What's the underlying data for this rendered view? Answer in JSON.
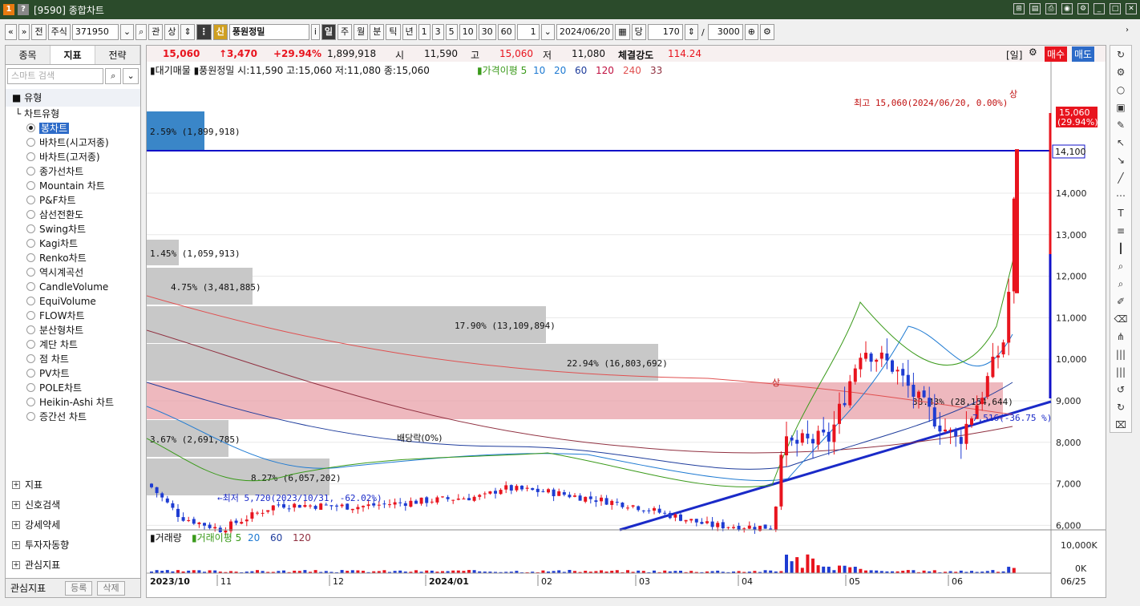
{
  "window": {
    "code": "[9590]",
    "title": "종합차트"
  },
  "toolbar": {
    "prev": "«",
    "next": "»",
    "all": "전",
    "market": "주식",
    "code": "371950",
    "search_btn": "⌕",
    "kwan": "관",
    "sang": "상",
    "sin": "신",
    "name": "풍원정밀",
    "info": "i",
    "periods": [
      "일",
      "주",
      "월",
      "분",
      "틱",
      "년"
    ],
    "active_period": "일",
    "nums": [
      "1",
      "3",
      "5",
      "10",
      "30",
      "60"
    ],
    "count": "1",
    "date": "2024/06/20",
    "dang": "당",
    "view": "170",
    "slash": "/",
    "total": "3000"
  },
  "left": {
    "tabs": [
      "종목",
      "지표",
      "전략"
    ],
    "active_tab": "지표",
    "search_placeholder": "스마트 검색",
    "group_label": "유형",
    "sub_label": "차트유형",
    "chart_types": [
      "봉차트",
      "바차트(시고저종)",
      "바차트(고저종)",
      "종가선차트",
      "Mountain 차트",
      "P&F차트",
      "삼선전환도",
      "Swing차트",
      "Kagi차트",
      "Renko차트",
      "역시계곡선",
      "CandleVolume",
      "EquiVolume",
      "FLOW차트",
      "분산형차트",
      "계단 차트",
      "점 차트",
      "PV차트",
      "POLE차트",
      "Heikin-Ashi 차트",
      "증간선 차트"
    ],
    "selected_type": "봉차트",
    "nodes": [
      "지표",
      "신호검색",
      "강세약세",
      "투자자동향",
      "관심지표"
    ],
    "footer": {
      "label": "관심지표",
      "register": "등록",
      "delete": "삭제"
    }
  },
  "quote": {
    "price": "15,060",
    "change": "↑3,470",
    "pct": "+29.94%",
    "volume": "1,899,918",
    "open_label": "시",
    "open": "11,590",
    "high_label": "고",
    "high": "15,060",
    "low_label": "저",
    "low": "11,080",
    "strength_label": "체결강도",
    "strength": "114.24",
    "mode": "[일]",
    "buy": "매수",
    "sell": "매도"
  },
  "legend": {
    "main": "▮대기매물 ▮풍원정밀 시:11,590 고:15,060 저:11,080 종:15,060",
    "ma_label": "▮가격이평 5",
    "ma": [
      "10",
      "20",
      "60",
      "120",
      "240",
      "33"
    ],
    "volume_title": "▮거래량",
    "vol_ma_label": "▮거래이평 5",
    "vol_ma": [
      "20",
      "60",
      "120"
    ]
  },
  "annotations": {
    "high": "최고 15,060(2024/06/20, 0.00%)",
    "low": "←최저 5,720(2023/10/31, -62.02%)",
    "dividend": "배당락(0%)",
    "trend": "7,516(-36.75 %)",
    "sang1": "상",
    "sang2": "상",
    "price_tag": "15,060",
    "price_tag_pct": "(29.94%)",
    "line_tag": "14,100"
  },
  "volume_profile": [
    {
      "label": "2.59% (1,899,918)"
    },
    {
      "label": "1.45% (1,059,913)"
    },
    {
      "label": "4.75% (3,481,885)"
    },
    {
      "label": "17.90% (13,109,894)"
    },
    {
      "label": "22.94% (16,803,692)"
    },
    {
      "label": "38.43% (28,154,644)"
    },
    {
      "label": "3.67% (2,691,785)"
    },
    {
      "label": "8.27% (6,057,202)"
    }
  ],
  "chart_data": {
    "type": "candlestick",
    "y_ticks": [
      "14,000",
      "13,000",
      "12,000",
      "11,000",
      "10,000",
      "9,000",
      "8,000",
      "7,000",
      "6,000"
    ],
    "vol_ticks": [
      "10,000K",
      "0K"
    ],
    "x_labels": [
      "2023/10",
      "11",
      "12",
      "2024/01",
      "02",
      "03",
      "04",
      "05",
      "06"
    ],
    "last_date": "06/25",
    "ylim": [
      5500,
      15500
    ]
  },
  "colors": {
    "up": "#e8141e",
    "down": "#1e3cd2",
    "hline": "#1010c8",
    "pink": "#e8a0a8",
    "gray": "#c8c8c8"
  }
}
